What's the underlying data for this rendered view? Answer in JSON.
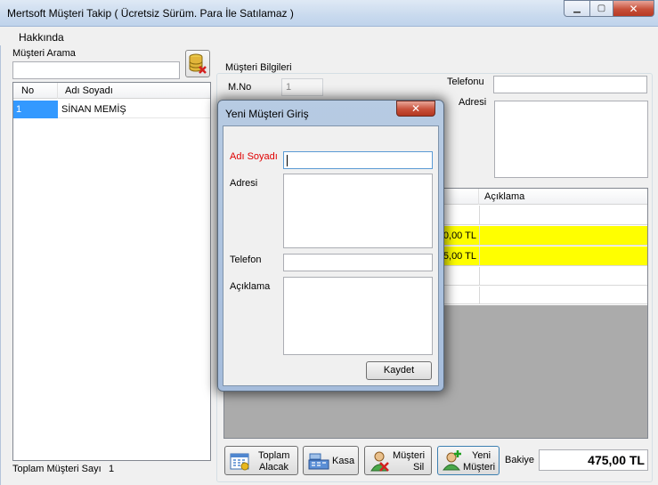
{
  "window": {
    "title": "Mertsoft Müşteri Takip ( Ücretsiz Sürüm. Para İle Satılamaz  )"
  },
  "menu": {
    "about": "Hakkında"
  },
  "search": {
    "label": "Müşteri Arama",
    "value": ""
  },
  "customer_grid": {
    "columns": [
      "No",
      "Adı Soyadı"
    ],
    "rows": [
      {
        "no": "1",
        "name": "SİNAN MEMİŞ"
      }
    ]
  },
  "customer_info": {
    "group_label": "Müşteri Bilgileri",
    "mno_label": "M.No",
    "mno_value": "1",
    "phone_label": "Telefonu",
    "address_label": "Adresi"
  },
  "transactions": {
    "columns": [
      "Açıklama"
    ],
    "rows": [
      {
        "amount": "0,00 TL"
      },
      {
        "amount": "5,00 TL"
      }
    ]
  },
  "footer": {
    "total_label": "Toplam Müşteri Sayı",
    "total_value": "1",
    "balance_label": "Bakiye",
    "balance_value": "475,00 TL"
  },
  "buttons": {
    "total_receivable_line1": "Toplam",
    "total_receivable_line2": "Alacak",
    "cash": "Kasa",
    "delete_line1": "Müşteri",
    "delete_line2": "Sil",
    "new_line1": "Yeni",
    "new_line2": "Müşteri"
  },
  "dialog": {
    "title": "Yeni Müşteri Giriş",
    "name_label": "Adı Soyadı",
    "address_label": "Adresi",
    "phone_label": "Telefon",
    "note_label": "Açıklama",
    "save": "Kaydet",
    "close_glyph": "✕"
  },
  "colors": {
    "name_label": "#e00000",
    "selection": "#3399ff",
    "highlight_row": "#ffff00"
  }
}
